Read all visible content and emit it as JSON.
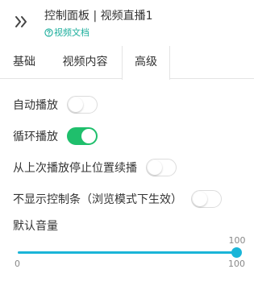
{
  "header": {
    "title": "控制面板 | 视频直播1",
    "doc_link": "视频文档",
    "collapse_icon": "double-chevron-right-icon",
    "help_icon": "question-circle-icon",
    "link_color": "#1aad9b"
  },
  "tabs": [
    {
      "label": "基础",
      "active": false
    },
    {
      "label": "视频内容",
      "active": false
    },
    {
      "label": "高级",
      "active": true
    }
  ],
  "settings": {
    "autoplay": {
      "label": "自动播放",
      "enabled": false
    },
    "loop": {
      "label": "循环播放",
      "enabled": true
    },
    "resume": {
      "label": "从上次播放停止位置续播",
      "enabled": false
    },
    "hide_controls": {
      "label": "不显示控制条（浏览模式下生效）",
      "enabled": false
    }
  },
  "volume": {
    "label": "默认音量",
    "value": "100",
    "min": "0",
    "max": "100",
    "fraction": 1.0,
    "accent_color": "#1ab5d8"
  },
  "colors": {
    "toggle_on": "#1fbf6c",
    "slider_accent": "#1ab5d8"
  }
}
